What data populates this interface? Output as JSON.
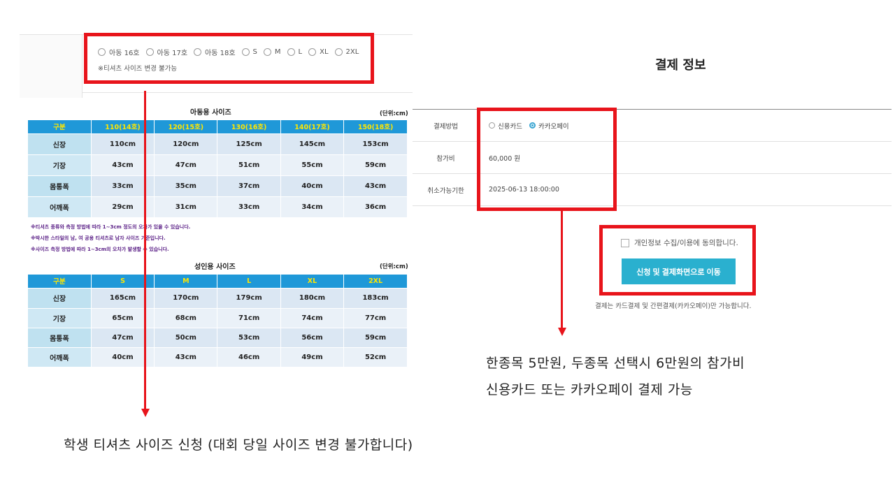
{
  "size_select": {
    "options": [
      "아동 16호",
      "아동 17호",
      "아동 18호",
      "S",
      "M",
      "L",
      "XL",
      "2XL"
    ],
    "note": "※티셔츠 사이즈 변경 불가능"
  },
  "kids_table": {
    "title": "아동용 사이즈",
    "unit": "(단위:cm)",
    "headers": [
      "구분",
      "110(14호)",
      "120(15호)",
      "130(16호)",
      "140(17호)",
      "150(18호)"
    ],
    "rows": [
      [
        "신장",
        "110cm",
        "120cm",
        "125cm",
        "145cm",
        "153cm"
      ],
      [
        "기장",
        "43cm",
        "47cm",
        "51cm",
        "55cm",
        "59cm"
      ],
      [
        "몸통폭",
        "33cm",
        "35cm",
        "37cm",
        "40cm",
        "43cm"
      ],
      [
        "어깨폭",
        "29cm",
        "31cm",
        "33cm",
        "34cm",
        "36cm"
      ]
    ]
  },
  "notes": [
    "※티셔츠 종류와 측정 방법에 따라 1~3cm 정도의 오차가 있을 수 있습니다.",
    "※박시한 스타일의 남, 여 공용 티셔츠로 남자 사이즈 기준입니다.",
    "※사이즈 측정 방법에 따라 1~3cm의 오차가 발생할 수 있습니다."
  ],
  "adult_table": {
    "title": "성인용 사이즈",
    "unit": "(단위:cm)",
    "headers": [
      "구분",
      "S",
      "M",
      "L",
      "XL",
      "2XL"
    ],
    "rows": [
      [
        "신장",
        "165cm",
        "170cm",
        "179cm",
        "180cm",
        "183cm"
      ],
      [
        "기장",
        "65cm",
        "68cm",
        "71cm",
        "74cm",
        "77cm"
      ],
      [
        "몸통폭",
        "47cm",
        "50cm",
        "53cm",
        "56cm",
        "59cm"
      ],
      [
        "어깨폭",
        "40cm",
        "43cm",
        "46cm",
        "49cm",
        "52cm"
      ]
    ]
  },
  "payment": {
    "title": "결제 정보",
    "method_label": "결제방법",
    "methods": [
      {
        "label": "신용카드",
        "selected": false
      },
      {
        "label": "카카오페이",
        "selected": true
      }
    ],
    "fee_label": "참가비",
    "fee_value": "60,000 원",
    "deadline_label": "취소가능기한",
    "deadline_value": "2025-06-13 18:00:00",
    "agree_label": "개인정보 수집/이용에 동의합니다.",
    "submit_label": "신청 및 결제화면으로 이동",
    "note": "결제는 카드결제 및 간편결제(카카오페이)만 가능합니다."
  },
  "captions": {
    "left": "학생 티셔츠 사이즈 신청 (대회 당일 사이즈 변경 불가합니다)",
    "right_line1": "한종목 5만원, 두종목 선택시 6만원의 참가비",
    "right_line2": "신용카드 또는 카카오페이 결제 가능"
  },
  "colors": {
    "highlight": "#e8141b",
    "table_header": "#1f98d8",
    "table_header_text": "#ffe600",
    "button": "#2ab0cf",
    "notes_text": "#5a1f86"
  }
}
